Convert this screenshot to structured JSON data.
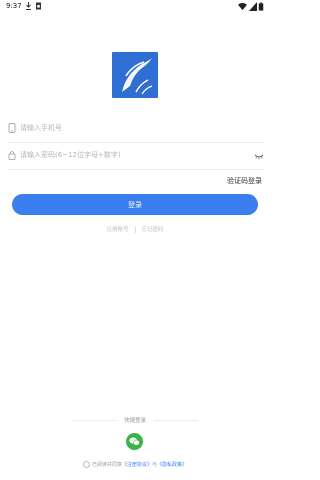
{
  "status_bar": {
    "time": "9:37"
  },
  "login": {
    "phone_placeholder": "请输入手机号",
    "password_placeholder": "请输入密码(6~12位字母+数字)",
    "code_login": "验证码登录",
    "login_button": "登录",
    "register": "注册账号",
    "forgot": "忘记密码"
  },
  "quick_login": {
    "label": "快捷登录"
  },
  "agreement": {
    "prefix": "已阅读并同意",
    "user_agreement": "《注册协议》",
    "and": "与",
    "privacy": "《隐私政策》"
  },
  "colors": {
    "primary": "#3b7ef0",
    "logo_bg": "#2f6fd4",
    "wechat": "#3cb34a"
  }
}
